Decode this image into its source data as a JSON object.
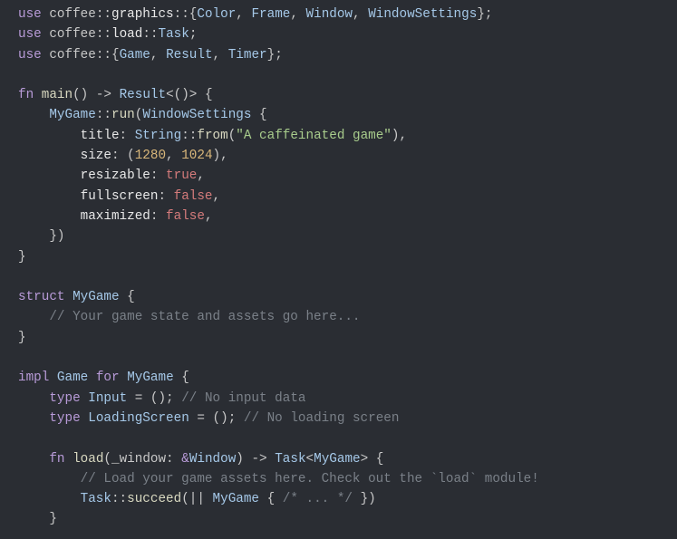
{
  "code": {
    "lines": [
      {
        "tokens": [
          {
            "t": "kw",
            "v": "use"
          },
          {
            "t": "punct",
            "v": " coffee"
          },
          {
            "t": "punct",
            "v": "::"
          },
          {
            "t": "ident",
            "v": "graphics"
          },
          {
            "t": "punct",
            "v": "::{"
          },
          {
            "t": "type",
            "v": "Color"
          },
          {
            "t": "punct",
            "v": ", "
          },
          {
            "t": "type",
            "v": "Frame"
          },
          {
            "t": "punct",
            "v": ", "
          },
          {
            "t": "type",
            "v": "Window"
          },
          {
            "t": "punct",
            "v": ", "
          },
          {
            "t": "type",
            "v": "WindowSettings"
          },
          {
            "t": "punct",
            "v": "};"
          }
        ]
      },
      {
        "tokens": [
          {
            "t": "kw",
            "v": "use"
          },
          {
            "t": "punct",
            "v": " coffee"
          },
          {
            "t": "punct",
            "v": "::"
          },
          {
            "t": "ident",
            "v": "load"
          },
          {
            "t": "punct",
            "v": "::"
          },
          {
            "t": "type",
            "v": "Task"
          },
          {
            "t": "punct",
            "v": ";"
          }
        ]
      },
      {
        "tokens": [
          {
            "t": "kw",
            "v": "use"
          },
          {
            "t": "punct",
            "v": " coffee"
          },
          {
            "t": "punct",
            "v": "::{"
          },
          {
            "t": "type",
            "v": "Game"
          },
          {
            "t": "punct",
            "v": ", "
          },
          {
            "t": "type",
            "v": "Result"
          },
          {
            "t": "punct",
            "v": ", "
          },
          {
            "t": "type",
            "v": "Timer"
          },
          {
            "t": "punct",
            "v": "};"
          }
        ]
      },
      {
        "tokens": [
          {
            "t": "blank",
            "v": " "
          }
        ]
      },
      {
        "tokens": [
          {
            "t": "kw",
            "v": "fn"
          },
          {
            "t": "punct",
            "v": " "
          },
          {
            "t": "fn",
            "v": "main"
          },
          {
            "t": "punct",
            "v": "() -> "
          },
          {
            "t": "type",
            "v": "Result"
          },
          {
            "t": "punct",
            "v": "<()> {"
          }
        ]
      },
      {
        "tokens": [
          {
            "t": "punct",
            "v": "    "
          },
          {
            "t": "type",
            "v": "MyGame"
          },
          {
            "t": "punct",
            "v": "::"
          },
          {
            "t": "fn",
            "v": "run"
          },
          {
            "t": "punct",
            "v": "("
          },
          {
            "t": "type",
            "v": "WindowSettings"
          },
          {
            "t": "punct",
            "v": " {"
          }
        ]
      },
      {
        "tokens": [
          {
            "t": "punct",
            "v": "        "
          },
          {
            "t": "attr",
            "v": "title"
          },
          {
            "t": "punct",
            "v": ": "
          },
          {
            "t": "type",
            "v": "String"
          },
          {
            "t": "punct",
            "v": "::"
          },
          {
            "t": "fn",
            "v": "from"
          },
          {
            "t": "punct",
            "v": "("
          },
          {
            "t": "str",
            "v": "\"A caffeinated game\""
          },
          {
            "t": "punct",
            "v": "),"
          }
        ]
      },
      {
        "tokens": [
          {
            "t": "punct",
            "v": "        "
          },
          {
            "t": "attr",
            "v": "size"
          },
          {
            "t": "punct",
            "v": ": ("
          },
          {
            "t": "num",
            "v": "1280"
          },
          {
            "t": "punct",
            "v": ", "
          },
          {
            "t": "num",
            "v": "1024"
          },
          {
            "t": "punct",
            "v": "),"
          }
        ]
      },
      {
        "tokens": [
          {
            "t": "punct",
            "v": "        "
          },
          {
            "t": "attr",
            "v": "resizable"
          },
          {
            "t": "punct",
            "v": ": "
          },
          {
            "t": "bool",
            "v": "true"
          },
          {
            "t": "punct",
            "v": ","
          }
        ]
      },
      {
        "tokens": [
          {
            "t": "punct",
            "v": "        "
          },
          {
            "t": "attr",
            "v": "fullscreen"
          },
          {
            "t": "punct",
            "v": ": "
          },
          {
            "t": "bool",
            "v": "false"
          },
          {
            "t": "punct",
            "v": ","
          }
        ]
      },
      {
        "tokens": [
          {
            "t": "punct",
            "v": "        "
          },
          {
            "t": "attr",
            "v": "maximized"
          },
          {
            "t": "punct",
            "v": ": "
          },
          {
            "t": "bool",
            "v": "false"
          },
          {
            "t": "punct",
            "v": ","
          }
        ]
      },
      {
        "tokens": [
          {
            "t": "punct",
            "v": "    })"
          }
        ]
      },
      {
        "tokens": [
          {
            "t": "punct",
            "v": "}"
          }
        ]
      },
      {
        "tokens": [
          {
            "t": "blank",
            "v": " "
          }
        ]
      },
      {
        "tokens": [
          {
            "t": "kw",
            "v": "struct"
          },
          {
            "t": "punct",
            "v": " "
          },
          {
            "t": "type",
            "v": "MyGame"
          },
          {
            "t": "punct",
            "v": " {"
          }
        ]
      },
      {
        "tokens": [
          {
            "t": "punct",
            "v": "    "
          },
          {
            "t": "comment",
            "v": "// Your game state and assets go here..."
          }
        ]
      },
      {
        "tokens": [
          {
            "t": "punct",
            "v": "}"
          }
        ]
      },
      {
        "tokens": [
          {
            "t": "blank",
            "v": " "
          }
        ]
      },
      {
        "tokens": [
          {
            "t": "kw",
            "v": "impl"
          },
          {
            "t": "punct",
            "v": " "
          },
          {
            "t": "type",
            "v": "Game"
          },
          {
            "t": "punct",
            "v": " "
          },
          {
            "t": "kw",
            "v": "for"
          },
          {
            "t": "punct",
            "v": " "
          },
          {
            "t": "type",
            "v": "MyGame"
          },
          {
            "t": "punct",
            "v": " {"
          }
        ]
      },
      {
        "tokens": [
          {
            "t": "punct",
            "v": "    "
          },
          {
            "t": "kw",
            "v": "type"
          },
          {
            "t": "punct",
            "v": " "
          },
          {
            "t": "type",
            "v": "Input"
          },
          {
            "t": "punct",
            "v": " = (); "
          },
          {
            "t": "comment",
            "v": "// No input data"
          }
        ]
      },
      {
        "tokens": [
          {
            "t": "punct",
            "v": "    "
          },
          {
            "t": "kw",
            "v": "type"
          },
          {
            "t": "punct",
            "v": " "
          },
          {
            "t": "type",
            "v": "LoadingScreen"
          },
          {
            "t": "punct",
            "v": " = (); "
          },
          {
            "t": "comment",
            "v": "// No loading screen"
          }
        ]
      },
      {
        "tokens": [
          {
            "t": "blank",
            "v": " "
          }
        ]
      },
      {
        "tokens": [
          {
            "t": "punct",
            "v": "    "
          },
          {
            "t": "kw",
            "v": "fn"
          },
          {
            "t": "punct",
            "v": " "
          },
          {
            "t": "fn",
            "v": "load"
          },
          {
            "t": "punct",
            "v": "(_window: "
          },
          {
            "t": "kw",
            "v": "&"
          },
          {
            "t": "type",
            "v": "Window"
          },
          {
            "t": "punct",
            "v": ") -> "
          },
          {
            "t": "type",
            "v": "Task"
          },
          {
            "t": "punct",
            "v": "<"
          },
          {
            "t": "type",
            "v": "MyGame"
          },
          {
            "t": "punct",
            "v": "> {"
          }
        ]
      },
      {
        "tokens": [
          {
            "t": "punct",
            "v": "        "
          },
          {
            "t": "comment",
            "v": "// Load your game assets here. Check out the `load` module!"
          }
        ]
      },
      {
        "tokens": [
          {
            "t": "punct",
            "v": "        "
          },
          {
            "t": "type",
            "v": "Task"
          },
          {
            "t": "punct",
            "v": "::"
          },
          {
            "t": "fn",
            "v": "succeed"
          },
          {
            "t": "punct",
            "v": "(|| "
          },
          {
            "t": "type",
            "v": "MyGame"
          },
          {
            "t": "punct",
            "v": " { "
          },
          {
            "t": "comment",
            "v": "/* ... */"
          },
          {
            "t": "punct",
            "v": " })"
          }
        ]
      },
      {
        "tokens": [
          {
            "t": "punct",
            "v": "    }"
          }
        ]
      }
    ]
  }
}
